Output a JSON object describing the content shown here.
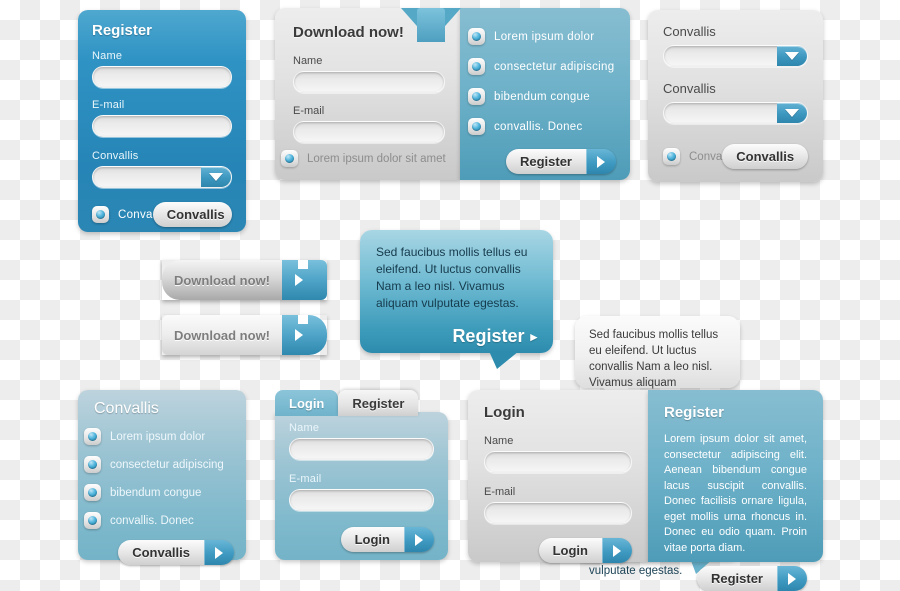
{
  "meta": {
    "accent_blue": "#2f93c4",
    "accent_teal": "#6fb3cb",
    "gray_panel": "#e2e2e2"
  },
  "register_panel": {
    "title": "Register",
    "name_label": "Name",
    "name_value": "",
    "email_label": "E-mail",
    "email_value": "",
    "select_label": "Convallis",
    "select_value": "",
    "checkbox_label": "Conva",
    "button_label": "Convallis"
  },
  "download_panel": {
    "title": "Download now!",
    "name_label": "Name",
    "name_value": "",
    "email_label": "E-mail",
    "email_value": "",
    "checkbox_label": "Lorem ipsum dolor sit amet",
    "bullets": [
      "Lorem   ipsum   dolor",
      "consectetur adipiscing",
      "bibendum  congue",
      "convallis.  Donec"
    ],
    "button_label": "Register"
  },
  "select_panel": {
    "label_one": "Convallis",
    "value_one": "",
    "label_two": "Convallis",
    "value_two": "",
    "checkbox_label": "Conva",
    "button_label": "Convallis"
  },
  "download_buttons": [
    {
      "label": "Download now!"
    },
    {
      "label": "Download now!"
    }
  ],
  "bubbles": {
    "big": {
      "text": "Sed faucibus mollis tellus eu eleifend. Ut luctus convallis Nam a leo nisl. Vivamus aliquam vulputate egestas.",
      "cta_label": "Register",
      "cta_arrow": "▸"
    },
    "gray": {
      "text": "Sed faucibus mollis tellus eu eleifend. Ut luctus convallis Nam a leo nisl. Vivamus aliquam vulputate egestas."
    },
    "small": {
      "text": "Sed faucibus mollis tellus eu eleifend. Ut luctus convallis Nam a leo nisl. Vivamus aliquam vulputate egestas."
    }
  },
  "convallis_list_panel": {
    "title": "Convallis",
    "bullets": [
      "Lorem   ipsum   dolor",
      "consectetur adipiscing",
      "bibendum  congue",
      "convallis.  Donec"
    ],
    "button_label": "Convallis"
  },
  "tabs_panel": {
    "tab_active": "Login",
    "tab_inactive": "Register",
    "name_label": "Name",
    "name_value": "",
    "email_label": "E-mail",
    "email_value": "",
    "button_label": "Login"
  },
  "split_panel": {
    "login": {
      "title": "Login",
      "name_label": "Name",
      "name_value": "",
      "email_label": "E-mail",
      "email_value": "",
      "button_label": "Login"
    },
    "register": {
      "title": "Register",
      "body": "Lorem ipsum dolor sit amet, consectetur adipiscing elit. Aenean bibendum congue lacus suscipit convallis. Donec facilisis ornare ligula, eget mollis urna rhoncus in. Donec eu odio quam. Proin vitae porta diam.",
      "button_label": "Register"
    }
  }
}
